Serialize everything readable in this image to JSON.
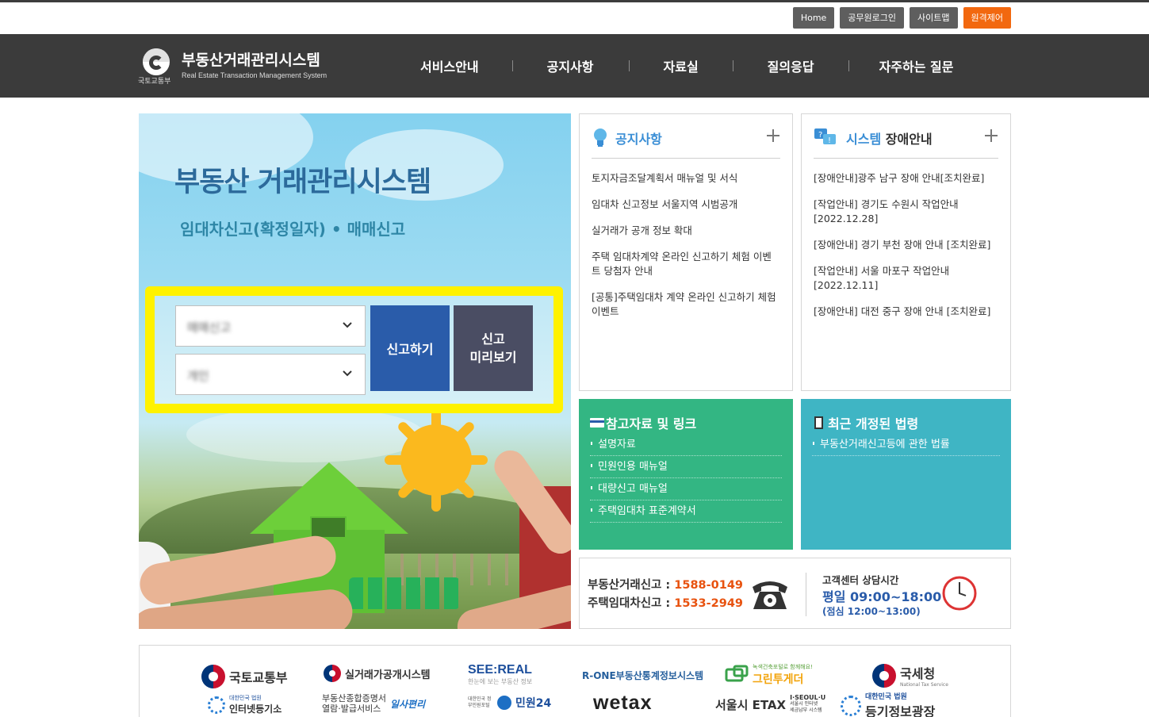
{
  "utility": {
    "home": "Home",
    "official_login": "공무원로그인",
    "sitemap": "사이트맵",
    "remote": "원격제어"
  },
  "header": {
    "ministry": "국토교통부",
    "title": "부동산거래관리시스템",
    "subtitle": "Real Estate Transaction Management System",
    "nav": [
      "서비스안내",
      "공지사항",
      "자료실",
      "질의응답",
      "자주하는 질문"
    ]
  },
  "hero": {
    "title": "부동산 거래관리시스템",
    "subtitle": "임대차신고(확정일자) • 매매신고",
    "select1_value": "매매신고",
    "select2_value": "개인",
    "report_button": "신고하기",
    "preview_button": "신고\n미리보기"
  },
  "notice": {
    "title": "공지사항",
    "items": [
      "토지자금조달계획서 매뉴얼 및 서식",
      "임대차 신고정보 서울지역 시범공개",
      "실거래가 공개 정보 확대",
      "주택 임대차계약 온라인 신고하기 체험 이벤트 당첨자 안내",
      "[공통]주택임대차 계약 온라인 신고하기 체험 이벤트"
    ]
  },
  "outage": {
    "title_blue": "시스템",
    "title_dark": "장애안내",
    "items": [
      "[장애안내]광주 남구 장애 안내[조치완료]",
      "[작업안내] 경기도 수원시 작업안내 [2022.12.28]",
      "[장애안내] 경기 부천 장애 안내 [조치완료]",
      "[작업안내] 서울 마포구 작업안내 [2022.12.11]",
      "[장애안내] 대전 중구 장애 안내 [조치완료]"
    ]
  },
  "reference": {
    "title": "참고자료 및 링크",
    "items": [
      "설명자료",
      "민원인용 매뉴얼",
      "대량신고 매뉴얼",
      "주택임대차 표준계약서"
    ]
  },
  "law": {
    "title": "최근 개정된 법령",
    "items": [
      "부동산거래신고등에 관한 법률"
    ]
  },
  "contact": {
    "line1_label": "부동산거래신고 : ",
    "line1_number": "1588-0149",
    "line2_label": "주택임대차신고 : ",
    "line2_number": "1533-2949",
    "hours_label": "고객센터 상담시간",
    "hours_weekday": "평일  09:00~18:00",
    "hours_lunch": "(점심 12:00~13:00)"
  },
  "links": {
    "molit": "국토교통부",
    "rtms": "실거래가공개시스템",
    "seereal": "SEE:REAL",
    "seereal_sub": "한눈에 보는 부동산 정보",
    "rone": "R-ONE부동산통계정보시스템",
    "green_sub": "녹색건축포털로 함께해요!",
    "green": "그린투게더",
    "nts": "국세청",
    "nts_sub": "National Tax Service",
    "iros_sub": "대한민국 법원",
    "iros": "인터넷등기소",
    "eais_1": "부동산종합증명서",
    "eais_2": "열람·발급서비스",
    "eais_brand": "일사편리",
    "minwon_sub": "대한민국 정부민원포털",
    "minwon": "민원24",
    "wetax": "wetax",
    "etax": "서울시 ETAX",
    "iseoul": "I·SEOUL·U",
    "iseoul_sub1": "서울시 인터넷",
    "iseoul_sub2": "세금납부 시스템",
    "registry_sub": "대한민국 법원",
    "registry": "등기정보광장"
  },
  "colors": {
    "header_bg": "#3b3b3b",
    "accent_blue": "#2a5caa",
    "preview_btn": "#4a4d63",
    "green_panel": "#33b683",
    "teal_panel": "#3fb5c4",
    "highlight_frame": "#fff200",
    "phone_number": "#e8520f",
    "remote_btn": "#f2680f"
  }
}
